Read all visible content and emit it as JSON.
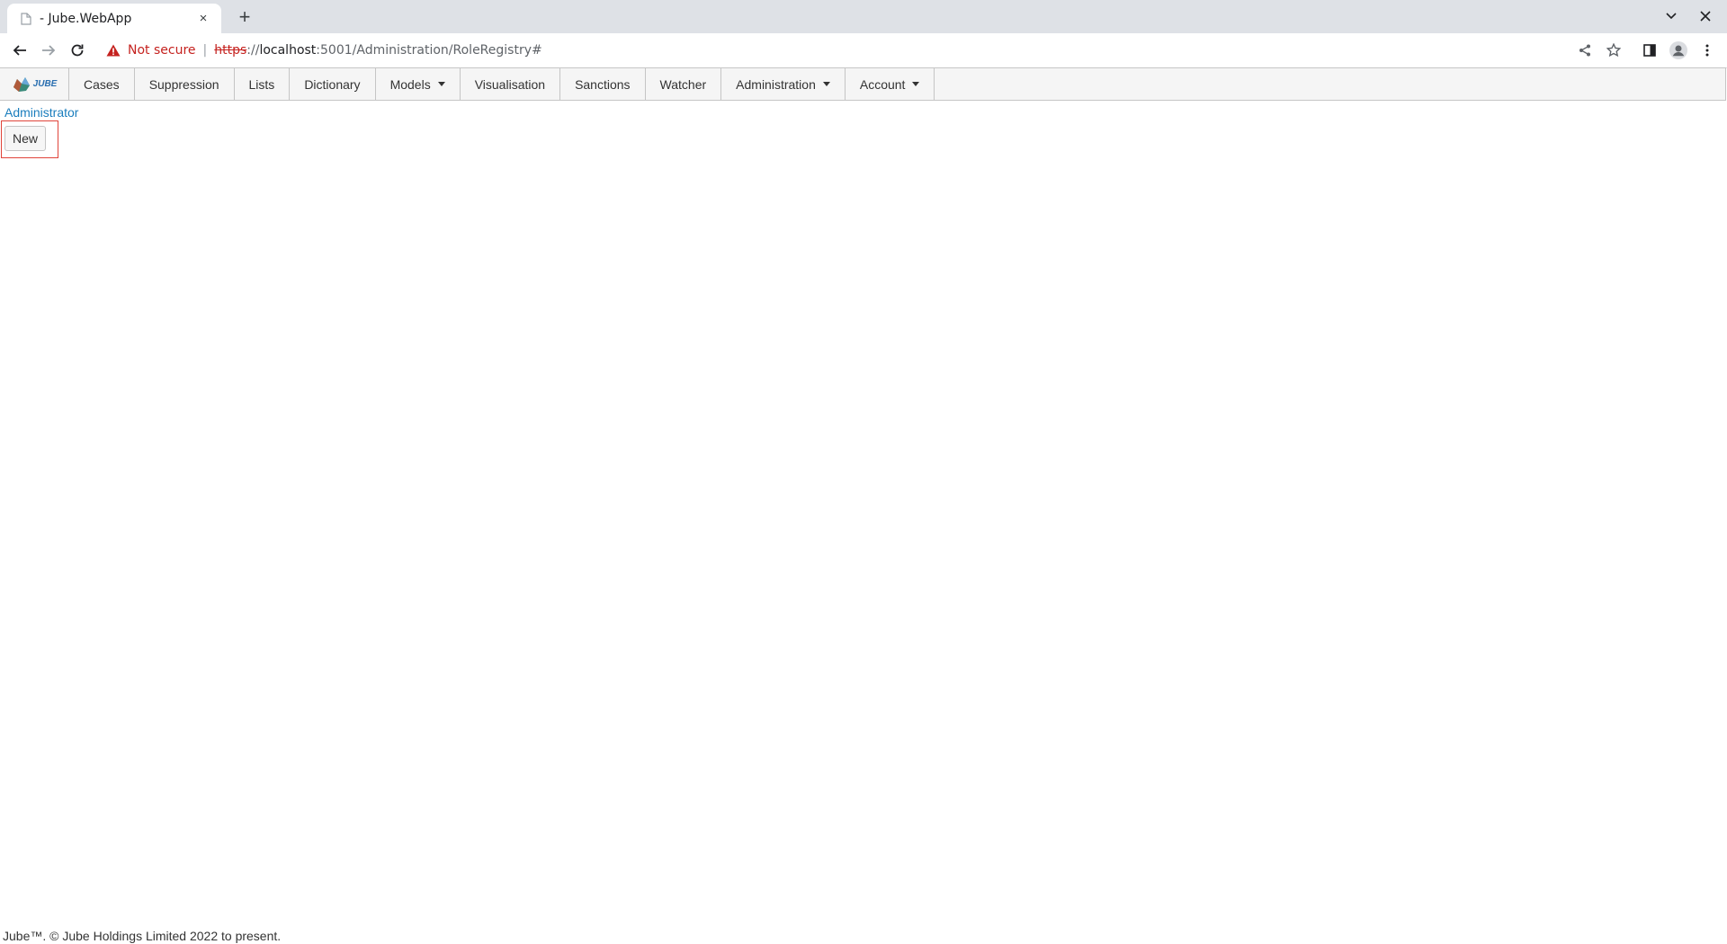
{
  "browser": {
    "tab": {
      "title": "- Jube.WebApp",
      "favicon": "page-icon",
      "close": "×"
    },
    "new_tab": "+",
    "window": {
      "dropdown": "⌄",
      "close": "✕"
    },
    "toolbar": {
      "back": "back-arrow-icon",
      "forward": "forward-arrow-icon",
      "reload": "reload-icon",
      "security_label": "Not secure",
      "url_scheme": "https",
      "url_sep": "://",
      "url_host": "localhost",
      "url_rest": ":5001/Administration/RoleRegistry#"
    }
  },
  "nav": {
    "logo_text": "JUBE",
    "items": [
      {
        "label": "Cases"
      },
      {
        "label": "Suppression"
      },
      {
        "label": "Lists"
      },
      {
        "label": "Dictionary"
      },
      {
        "label": "Models",
        "dropdown": true
      },
      {
        "label": "Visualisation"
      },
      {
        "label": "Sanctions"
      },
      {
        "label": "Watcher"
      },
      {
        "label": "Administration",
        "dropdown": true
      },
      {
        "label": "Account",
        "dropdown": true
      }
    ]
  },
  "content": {
    "breadcrumb": "Administrator",
    "new_button": "New"
  },
  "footer": {
    "text": "Jube™. © Jube Holdings Limited 2022 to present."
  },
  "colors": {
    "link": "#1a7dbd",
    "highlight": "#e0443a",
    "warning": "#c5221f"
  }
}
